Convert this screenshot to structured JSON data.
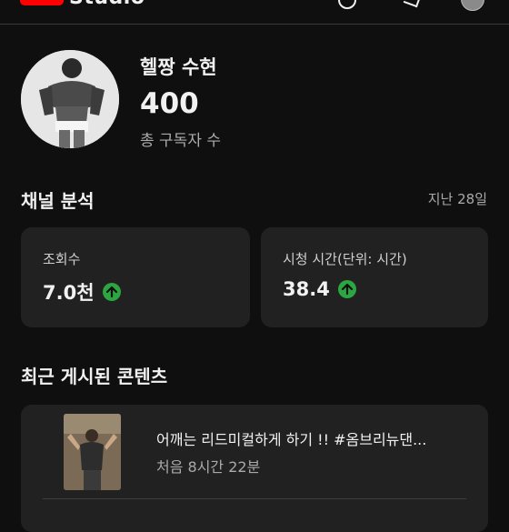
{
  "header": {
    "app_name": "Studio",
    "icons": [
      "help-icon",
      "feedback-icon",
      "account-avatar"
    ]
  },
  "channel": {
    "name": "헬짱 수현",
    "subscriber_count": "400",
    "subscriber_label": "총 구독자 수"
  },
  "analytics": {
    "title": "채널 분석",
    "period": "지난 28일",
    "metrics": [
      {
        "label": "조회수",
        "value": "7.0천",
        "trend": "up-arrow-icon"
      },
      {
        "label": "시청 시간(단위: 시간)",
        "value": "38.4",
        "trend": "up-arrow-icon"
      }
    ]
  },
  "recent_content": {
    "title": "최근 게시된 콘텐츠",
    "items": [
      {
        "title": "어깨는 리드미컬하게 하기 !! #옴브리뉴댄...",
        "meta": "처음 8시간 22분"
      }
    ]
  },
  "colors": {
    "background": "#0f0f0f",
    "card": "#212121",
    "trend_up": "#2ba640",
    "brand_red": "#ff0000"
  }
}
